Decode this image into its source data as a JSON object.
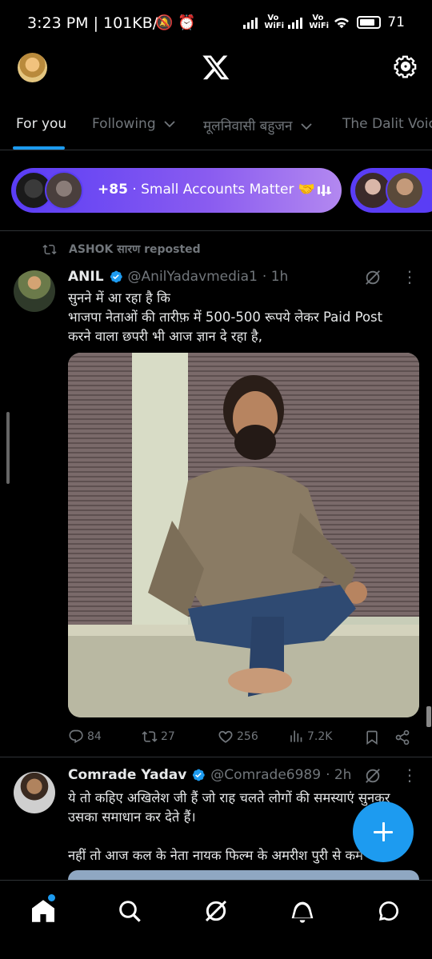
{
  "status_bar": {
    "time": "3:23 PM | 101KB/s",
    "battery_percent": "71",
    "wifi_label": "Vo WiFi"
  },
  "header": {
    "logo": "X"
  },
  "tabs": [
    {
      "label": "For you",
      "active": true
    },
    {
      "label": "Following",
      "dropdown": true
    },
    {
      "label": "मूलनिवासी बहुजन",
      "dropdown": true
    },
    {
      "label": "The Dalit Voic"
    }
  ],
  "spaces": {
    "listener_count": "+85",
    "title": "Small Accounts Matter 🤝 ...",
    "accent": "#5a3df5"
  },
  "tweets": [
    {
      "repost_by": "ASHOK सारण reposted",
      "name": "ANIL",
      "handle": "@AnilYadavmedia1",
      "time": "· 1h",
      "text_lines": [
        "सुनने में आ रहा है कि",
        "भाजपा नेताओं की तारीफ़ में 500-500 रूपये लेकर Paid Post",
        "करने वाला छपरी भी आज ज्ञान दे रहा है,"
      ],
      "replies": "84",
      "reposts": "27",
      "likes": "256",
      "views": "7.2K"
    },
    {
      "name": "Comrade Yadav",
      "handle": "@Comrade6989",
      "time": "· 2h",
      "text_lines": [
        "ये तो कहिए अखिलेश जी हैं जो राह चलते  लोगों की समस्याएं सुनकर",
        "उसका समाधान कर देते हैं।",
        "",
        "नहीं तो आज कल के नेता नायक फिल्म के अमरीश पुरी से कम"
      ]
    }
  ],
  "bottom_nav": [
    "home-icon",
    "search-icon",
    "grok-icon",
    "notifications-icon",
    "messages-icon"
  ],
  "colors": {
    "accent": "#1d9bf0",
    "muted": "#71767b",
    "text": "#e7e9ea"
  }
}
